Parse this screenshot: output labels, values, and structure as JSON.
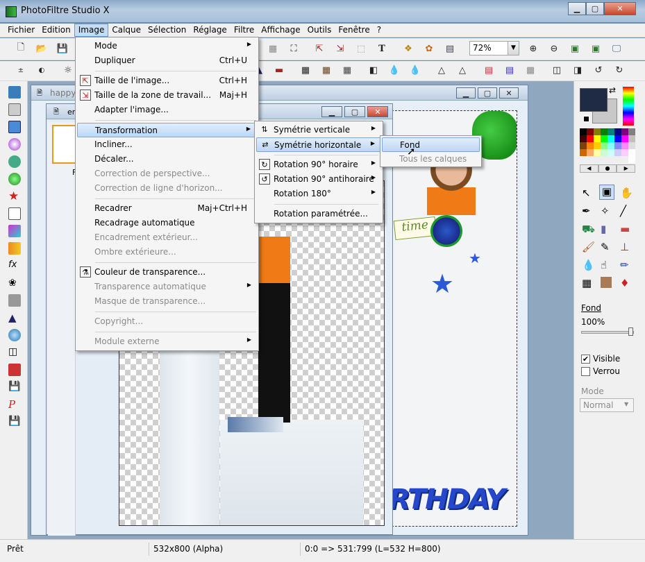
{
  "window": {
    "title": "PhotoFiltre Studio X"
  },
  "menubar": [
    "Fichier",
    "Edition",
    "Image",
    "Calque",
    "Sélection",
    "Réglage",
    "Filtre",
    "Affichage",
    "Outils",
    "Fenêtre",
    "?"
  ],
  "toolbar": {
    "zoom": "72%"
  },
  "documents": {
    "back_title": "happy..",
    "front_title": "en",
    "layer_label": "F"
  },
  "image_menu": {
    "items": [
      {
        "label": "Mode",
        "submenu": true
      },
      {
        "label": "Dupliquer",
        "shortcut": "Ctrl+U"
      },
      {
        "label": "Taille de l'image...",
        "shortcut": "Ctrl+H",
        "icon": "image-size-icon"
      },
      {
        "label": "Taille de la zone de travail...",
        "shortcut": "Maj+H",
        "icon": "canvas-size-icon"
      },
      {
        "label": "Adapter l'image..."
      },
      {
        "label": "Transformation",
        "submenu": true,
        "highlighted": true
      },
      {
        "label": "Incliner..."
      },
      {
        "label": "Décaler..."
      },
      {
        "label": "Correction de perspective...",
        "disabled": true
      },
      {
        "label": "Correction de ligne d'horizon...",
        "disabled": true
      },
      {
        "label": "Recadrer",
        "shortcut": "Maj+Ctrl+H"
      },
      {
        "label": "Recadrage automatique"
      },
      {
        "label": "Encadrement extérieur...",
        "disabled": true
      },
      {
        "label": "Ombre extérieure...",
        "disabled": true
      },
      {
        "label": "Couleur de transparence...",
        "icon": "transparency-color-icon"
      },
      {
        "label": "Transparence automatique",
        "disabled": true,
        "submenu": true
      },
      {
        "label": "Masque de transparence...",
        "disabled": true
      },
      {
        "label": "Copyright...",
        "disabled": true
      },
      {
        "label": "Module externe",
        "disabled": true,
        "submenu": true
      }
    ]
  },
  "transformation_menu": {
    "items": [
      {
        "label": "Symétrie verticale",
        "submenu": true
      },
      {
        "label": "Symétrie horizontale",
        "submenu": true,
        "highlighted": true
      },
      {
        "label": "Rotation 90° horaire",
        "submenu": true
      },
      {
        "label": "Rotation 90° antihoraire",
        "submenu": true
      },
      {
        "label": "Rotation 180°",
        "submenu": true
      },
      {
        "label": "Rotation paramétrée..."
      }
    ]
  },
  "horizontal_menu": {
    "items": [
      {
        "label": "Fond",
        "highlighted": true
      },
      {
        "label": "Tous les calques",
        "disabled": true
      }
    ]
  },
  "layers_panel": {
    "layer_name": "Fond",
    "opacity": "100%",
    "visible_label": "Visible",
    "visible_checked": true,
    "lock_label": "Verrou",
    "lock_checked": false,
    "mode_label": "Mode",
    "mode_value": "Normal"
  },
  "canvas_text": {
    "time_sticker": "time",
    "birthday": "RTHDAY"
  },
  "statusbar": {
    "status": "Prêt",
    "size": "532x800 (Alpha)",
    "coords": "0:0 => 531:799 (L=532  H=800)"
  },
  "colors": {
    "accent": "#c5dcf5",
    "foreground": "#1f2a44",
    "background": "#c8c8c8"
  }
}
